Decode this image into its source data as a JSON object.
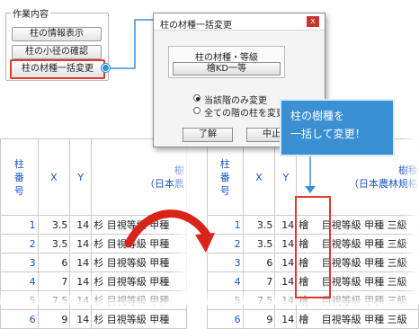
{
  "panel": {
    "title": "作業内容",
    "buttons": [
      "柱の情報表示",
      "柱の小径の確認",
      "柱の材種一括変更"
    ]
  },
  "dialog": {
    "title": "柱の材種一括変更",
    "close_glyph": "x",
    "group_label": "柱の材種・等級",
    "material_value": "檜KD一等",
    "radio_options": [
      "当該階のみ変更",
      "全ての階の柱を変更"
    ],
    "selected_radio": 0,
    "ok_label": "了解",
    "cancel_label": "中止"
  },
  "callout": {
    "line1": "柱の樹種を",
    "line2": "一括して変更！"
  },
  "left_table": {
    "head": {
      "col1_lines": [
        "柱",
        "番",
        "号"
      ],
      "x": "X",
      "y": "Y",
      "material_line1": "樹",
      "material_line2": "（日本農"
    },
    "rows": [
      {
        "no": "1",
        "x": "3.5",
        "y": "14",
        "material": "杉 目視等級 甲種"
      },
      {
        "no": "2",
        "x": "3.5",
        "y": "14",
        "material": "杉 目視等級 甲種"
      },
      {
        "no": "3",
        "x": "6",
        "y": "14",
        "material": "杉 目視等級 甲種"
      },
      {
        "no": "4",
        "x": "7",
        "y": "14",
        "material": "杉 目視等級 甲種"
      },
      {
        "no": "5",
        "x": "7.5",
        "y": "14",
        "material": "杉 目視等級 甲種"
      },
      {
        "no": "6",
        "x": "9",
        "y": "14",
        "material": "杉 目視等級 甲種"
      }
    ]
  },
  "right_table": {
    "head": {
      "col1_lines": [
        "柱",
        "番",
        "号"
      ],
      "x": "X",
      "y": "Y",
      "material_line1": "樹種",
      "material_line2": "（日本農林規格"
    },
    "rows": [
      {
        "no": "1",
        "x": "3.5",
        "y": "14",
        "species": "檜",
        "grade": "目視等級 甲種 三級"
      },
      {
        "no": "2",
        "x": "3.5",
        "y": "14",
        "species": "檜",
        "grade": "目視等級 甲種 三級"
      },
      {
        "no": "3",
        "x": "6",
        "y": "14",
        "species": "檜",
        "grade": "目視等級 甲種 三級"
      },
      {
        "no": "4",
        "x": "7",
        "y": "14",
        "species": "檜",
        "grade": "目視等級 甲種 三級"
      },
      {
        "no": "5",
        "x": "7.5",
        "y": "14",
        "species": "檜",
        "grade": "目視等級 甲種 三級"
      },
      {
        "no": "6",
        "x": "9",
        "y": "14",
        "species": "檜",
        "grade": "目視等級 甲種 三級"
      }
    ]
  },
  "colors": {
    "accent_blue": "#3b8fd3",
    "highlight_red": "#e03a2a",
    "header_text": "#1a56c8",
    "arrow_red": "#d8241b"
  }
}
